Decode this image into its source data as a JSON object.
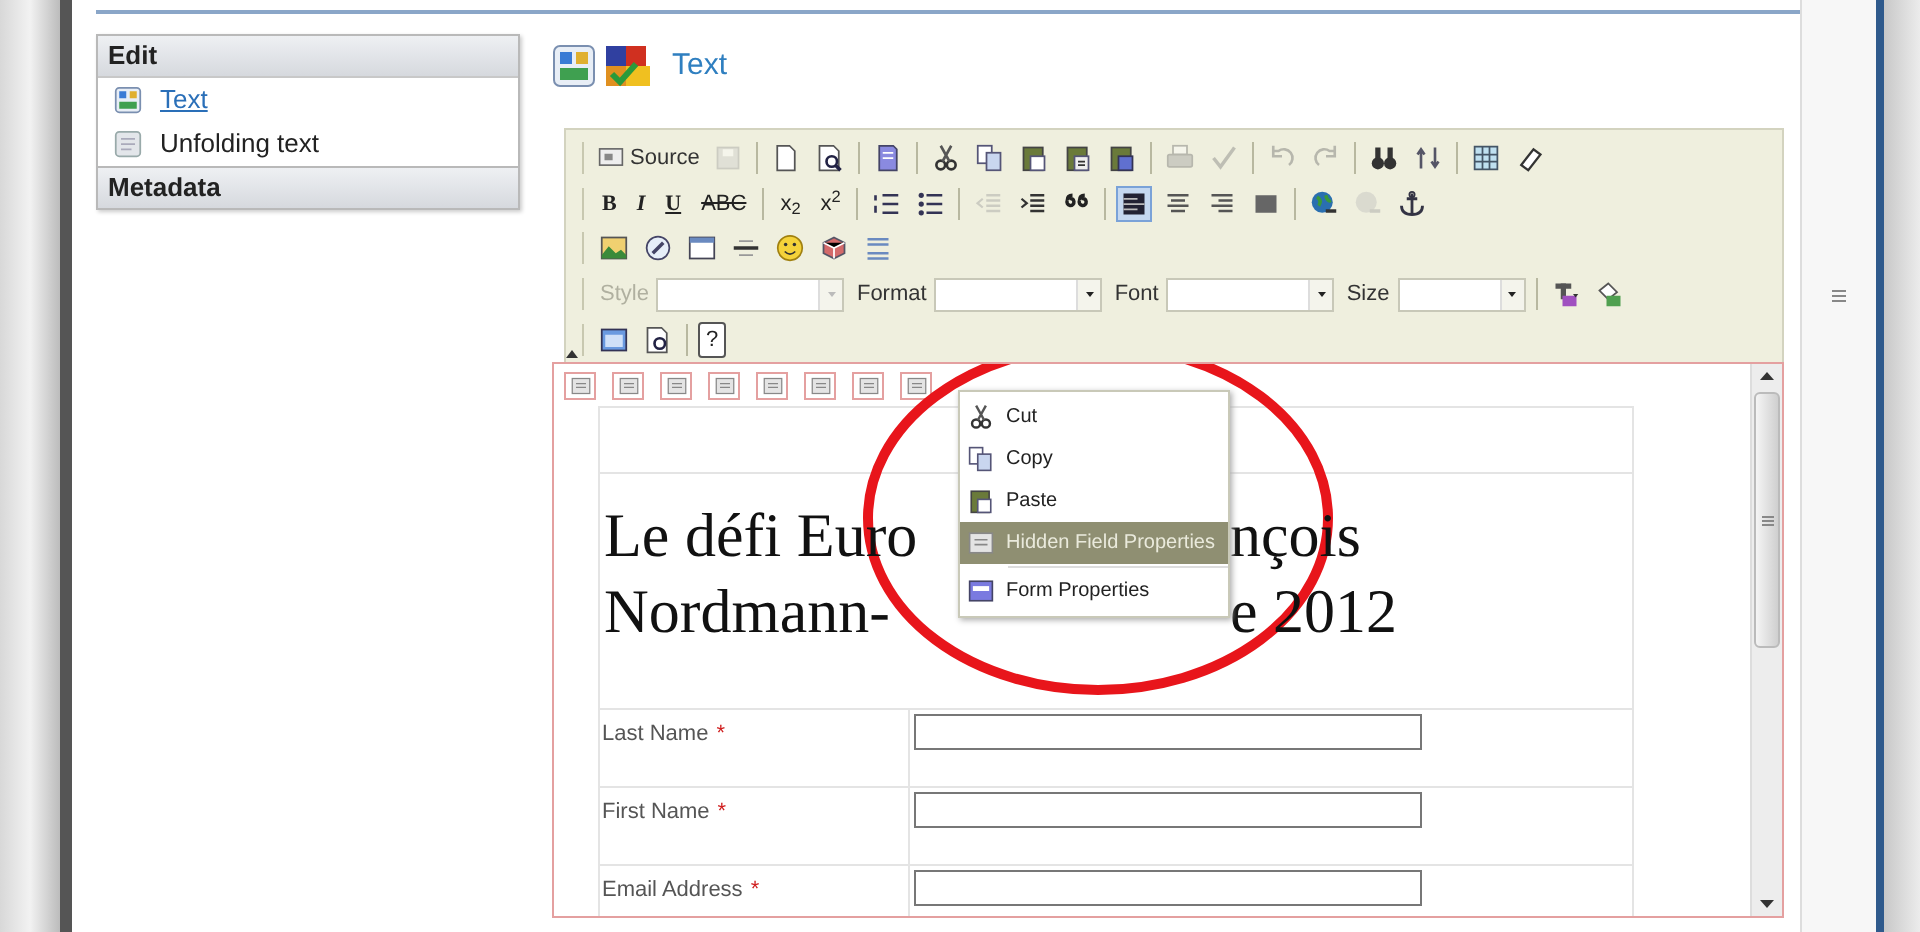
{
  "sidebar": {
    "sections": [
      {
        "title": "Edit",
        "items": [
          {
            "label": "Text",
            "kind": "link"
          },
          {
            "label": "Unfolding text",
            "kind": "plain"
          }
        ]
      },
      {
        "title": "Metadata"
      }
    ]
  },
  "page_title": "Text",
  "toolbar": {
    "rows": [
      {
        "items": [
          {
            "kind": "button",
            "label": "Source",
            "disabled": false
          },
          {
            "kind": "icon",
            "disabled": true
          },
          {
            "kind": "sep"
          },
          {
            "kind": "icon",
            "disabled": false
          },
          {
            "kind": "icon",
            "disabled": false
          },
          {
            "kind": "sep"
          },
          {
            "kind": "icon",
            "disabled": false
          },
          {
            "kind": "sep"
          },
          {
            "kind": "icon",
            "disabled": false
          },
          {
            "kind": "icon",
            "disabled": false
          },
          {
            "kind": "icon",
            "disabled": false
          },
          {
            "kind": "icon",
            "disabled": false
          },
          {
            "kind": "icon",
            "disabled": false
          },
          {
            "kind": "sep"
          },
          {
            "kind": "icon",
            "disabled": true
          },
          {
            "kind": "icon",
            "disabled": true
          },
          {
            "kind": "sep"
          },
          {
            "kind": "icon",
            "disabled": true
          },
          {
            "kind": "icon",
            "disabled": true
          },
          {
            "kind": "sep"
          },
          {
            "kind": "icon",
            "disabled": false
          },
          {
            "kind": "icon",
            "disabled": false
          },
          {
            "kind": "sep"
          },
          {
            "kind": "icon",
            "disabled": false
          },
          {
            "kind": "icon",
            "disabled": false
          }
        ]
      },
      {
        "items": [
          {
            "kind": "glyph",
            "text": "B"
          },
          {
            "kind": "glyph",
            "text": "I"
          },
          {
            "kind": "glyph",
            "text": "U"
          },
          {
            "kind": "glyph",
            "text": "ABC"
          },
          {
            "kind": "sep"
          },
          {
            "kind": "glyph",
            "text": "x$_{2}$"
          },
          {
            "kind": "glyph",
            "text": "x$^{2}$"
          },
          {
            "kind": "sep"
          },
          {
            "kind": "icon",
            "disabled": false
          },
          {
            "kind": "icon",
            "disabled": false
          },
          {
            "kind": "sep"
          },
          {
            "kind": "icon",
            "disabled": true
          },
          {
            "kind": "icon",
            "disabled": false
          },
          {
            "kind": "icon",
            "disabled": false
          },
          {
            "kind": "sep"
          },
          {
            "kind": "icon",
            "disabled": false,
            "selected": true
          },
          {
            "kind": "icon",
            "disabled": false,
            "selected": false
          },
          {
            "kind": "icon",
            "disabled": false,
            "selected": false
          },
          {
            "kind": "icon",
            "disabled": false,
            "selected": false
          },
          {
            "kind": "sep"
          },
          {
            "kind": "icon",
            "disabled": false
          },
          {
            "kind": "icon",
            "disabled": true
          },
          {
            "kind": "icon",
            "disabled": false
          }
        ]
      },
      {
        "items": [
          {
            "kind": "icon",
            "disabled": false
          },
          {
            "kind": "icon",
            "disabled": false
          },
          {
            "kind": "icon",
            "disabled": false
          },
          {
            "kind": "icon",
            "disabled": false
          },
          {
            "kind": "icon",
            "disabled": false
          },
          {
            "kind": "icon",
            "disabled": false
          },
          {
            "kind": "icon",
            "disabled": false
          }
        ]
      },
      {
        "items": [
          {
            "kind": "combo",
            "label": "Style",
            "disabled": true
          },
          {
            "kind": "combo",
            "label": "Format",
            "disabled": false
          },
          {
            "kind": "combo",
            "label": "Font",
            "disabled": false
          },
          {
            "kind": "combo",
            "label": "Size",
            "disabled": false
          },
          {
            "kind": "sep"
          },
          {
            "kind": "icon",
            "disabled": false
          },
          {
            "kind": "icon",
            "disabled": false
          }
        ]
      },
      {
        "items": [
          {
            "kind": "icon",
            "disabled": false
          },
          {
            "kind": "icon",
            "disabled": false
          },
          {
            "kind": "sep"
          },
          {
            "kind": "glyph",
            "text": "?"
          }
        ]
      }
    ]
  },
  "document": {
    "heading_lines": [
      [
        "Le défi Euro",
        "nçois"
      ],
      [
        "Nordmann-",
        "e 2012"
      ]
    ],
    "fields": [
      {
        "label": "Last Name",
        "required_mark": "*"
      },
      {
        "label": "First Name",
        "required_mark": "*"
      },
      {
        "label": "Email Address",
        "required_mark": "*"
      }
    ]
  },
  "context_menu": {
    "items": [
      {
        "label": "Cut",
        "selected": false
      },
      {
        "label": "Copy",
        "selected": false
      },
      {
        "label": "Paste",
        "selected": false
      },
      {
        "label": "Hidden Field Properties",
        "selected": true
      },
      {
        "label": "Form Properties",
        "selected": false
      }
    ]
  }
}
